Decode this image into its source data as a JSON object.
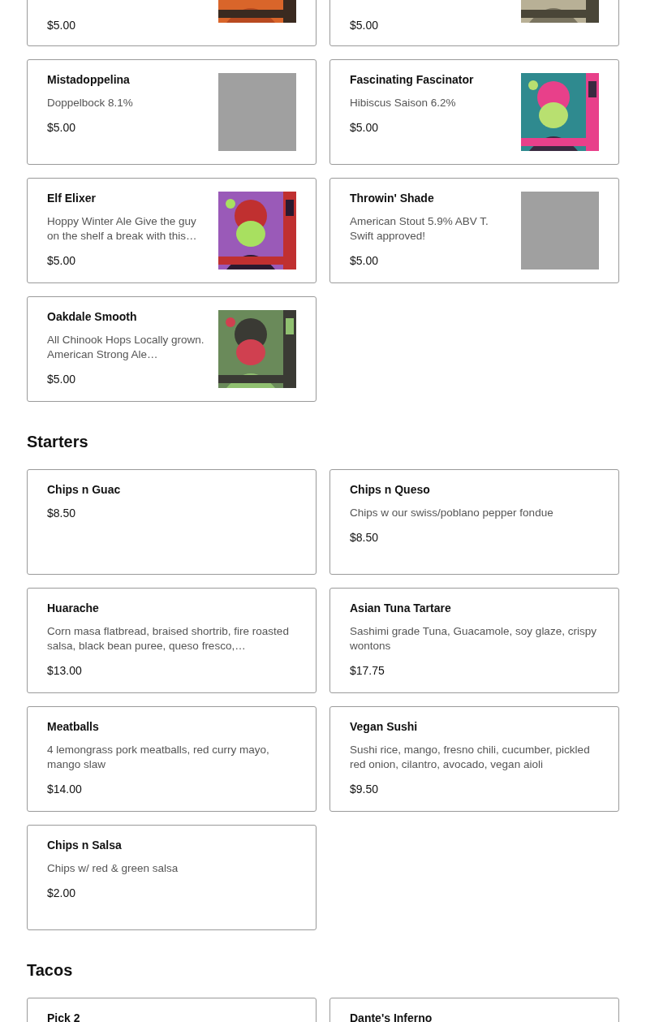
{
  "sections": [
    {
      "items": [
        {
          "price": "$5.00"
        },
        {
          "price": "$5.00"
        },
        {
          "title": "Mistadoppelina",
          "description": "Doppelbock 8.1%",
          "price": "$5.00",
          "image": {
            "kind": "placeholder"
          }
        },
        {
          "title": "Fascinating Fascinator",
          "description": "Hibiscus Saison 6.2%",
          "price": "$5.00"
        },
        {
          "title": "Elf Elixer",
          "description": "Hoppy Winter Ale Give the guy on the shelf a break with this…",
          "price": "$5.00"
        },
        {
          "title": "Throwin' Shade",
          "description": "American Stout 5.9% ABV T. Swift approved!",
          "price": "$5.00",
          "image": {
            "kind": "placeholder"
          }
        },
        {
          "title": "Oakdale Smooth",
          "description": "All Chinook Hops Locally grown. American Strong Ale…",
          "price": "$5.00"
        }
      ]
    },
    {
      "heading": "Starters",
      "items": [
        {
          "title": "Chips n Guac",
          "price": "$8.50"
        },
        {
          "title": "Chips n Queso",
          "description": "Chips w our swiss/poblano pepper fondue",
          "price": "$8.50"
        },
        {
          "title": "Huarache",
          "description": "Corn masa flatbread, braised shortrib, fire roasted salsa, black bean puree, queso fresco,…",
          "price": "$13.00"
        },
        {
          "title": "Asian Tuna Tartare",
          "description": "Sashimi grade Tuna, Guacamole, soy glaze, crispy wontons",
          "price": "$17.75"
        },
        {
          "title": "Meatballs",
          "description": "4 lemongrass pork meatballs, red curry mayo, mango slaw",
          "price": "$14.00"
        },
        {
          "title": "Vegan Sushi",
          "description": "Sushi rice, mango, fresno chili, cucumber, pickled red onion, cilantro, avocado, vegan aioli",
          "price": "$9.50"
        },
        {
          "title": "Chips n Salsa",
          "description": "Chips w/ red & green salsa",
          "price": "$2.00"
        }
      ]
    },
    {
      "heading": "Tacos",
      "items": [
        {
          "title": "Pick 2"
        },
        {
          "title": "Dante's Inferno"
        }
      ]
    }
  ]
}
